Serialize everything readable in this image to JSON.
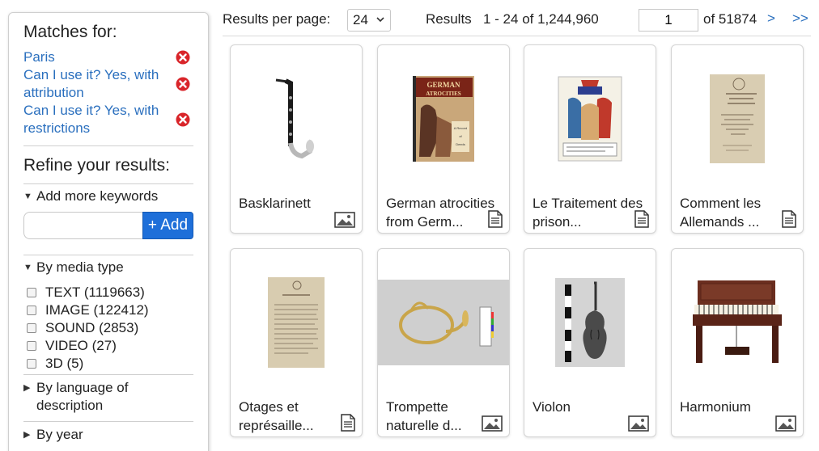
{
  "sidebar": {
    "matches_heading": "Matches for:",
    "matches": [
      {
        "label": "Paris"
      },
      {
        "label": "Can I use it? Yes, with attribution"
      },
      {
        "label": "Can I use it? Yes, with restrictions"
      }
    ],
    "refine_heading": "Refine your results:",
    "keywords": {
      "label": "Add more keywords",
      "placeholder": "",
      "button": "+ Add"
    },
    "media_type": {
      "label": "By media type",
      "items": [
        {
          "label": "TEXT (1119663)"
        },
        {
          "label": "IMAGE (122412)"
        },
        {
          "label": "SOUND (2853)"
        },
        {
          "label": "VIDEO (27)"
        },
        {
          "label": "3D (5)"
        }
      ]
    },
    "language": {
      "label": "By language of description"
    },
    "year": {
      "label": "By year"
    }
  },
  "topbar": {
    "per_page_label": "Results per page:",
    "per_page_value": "24",
    "results_label": "Results",
    "results_range": "1 - 24 of 1,244,960",
    "page_value": "1",
    "of_pages": "of 51874",
    "next": ">",
    "last": ">>"
  },
  "results": [
    {
      "title": "Basklarinett",
      "type_icon": "image-icon"
    },
    {
      "title": "German atrocities from Germ...",
      "type_icon": "document-icon"
    },
    {
      "title": "Le Traitement des prison...",
      "type_icon": "document-icon"
    },
    {
      "title": "Comment les Allemands ...",
      "type_icon": "document-icon"
    },
    {
      "title": "Otages et représaille...",
      "type_icon": "document-icon"
    },
    {
      "title": "Trompette naturelle d...",
      "type_icon": "image-icon"
    },
    {
      "title": "Violon",
      "type_icon": "image-icon"
    },
    {
      "title": "Harmonium",
      "type_icon": "image-icon"
    }
  ],
  "thumb_titles": {
    "german_atrocities": "GERMAN ATROCITIES",
    "german_atrocities_sub": "A Record of Shameless Deeds"
  },
  "colors": {
    "link": "#2a6fbe",
    "add_button": "#1e6fd9",
    "remove": "#d9252a"
  }
}
